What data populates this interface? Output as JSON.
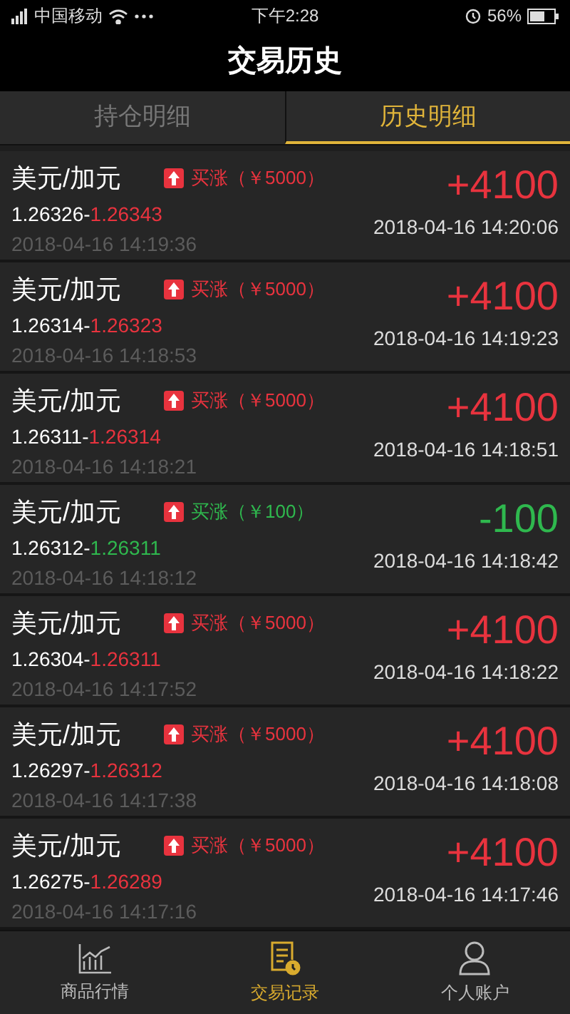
{
  "status_bar": {
    "carrier": "中国移动",
    "time": "下午2:28",
    "battery": "56%"
  },
  "header": {
    "title": "交易历史"
  },
  "tabs": [
    {
      "label": "持仓明细",
      "selected": false
    },
    {
      "label": "历史明细",
      "selected": true
    }
  ],
  "trades": [
    {
      "pair": "美元/加元",
      "direction": "买涨（￥5000）",
      "open_price": "1.26326",
      "separator": "-",
      "close_price": "1.26343",
      "open_time": "2018-04-16 14:19:36",
      "profit": "+4100",
      "close_time": "2018-04-16 14:20:06",
      "kind": "gain"
    },
    {
      "pair": "美元/加元",
      "direction": "买涨（￥5000）",
      "open_price": "1.26314",
      "separator": "-",
      "close_price": "1.26323",
      "open_time": "2018-04-16 14:18:53",
      "profit": "+4100",
      "close_time": "2018-04-16 14:19:23",
      "kind": "gain"
    },
    {
      "pair": "美元/加元",
      "direction": "买涨（￥5000）",
      "open_price": "1.26311",
      "separator": "-",
      "close_price": "1.26314",
      "open_time": "2018-04-16 14:18:21",
      "profit": "+4100",
      "close_time": "2018-04-16 14:18:51",
      "kind": "gain"
    },
    {
      "pair": "美元/加元",
      "direction": "买涨（￥100）",
      "open_price": "1.26312",
      "separator": "-",
      "close_price": "1.26311",
      "open_time": "2018-04-16 14:18:12",
      "profit": "-100",
      "close_time": "2018-04-16 14:18:42",
      "kind": "loss"
    },
    {
      "pair": "美元/加元",
      "direction": "买涨（￥5000）",
      "open_price": "1.26304",
      "separator": "-",
      "close_price": "1.26311",
      "open_time": "2018-04-16 14:17:52",
      "profit": "+4100",
      "close_time": "2018-04-16 14:18:22",
      "kind": "gain"
    },
    {
      "pair": "美元/加元",
      "direction": "买涨（￥5000）",
      "open_price": "1.26297",
      "separator": "-",
      "close_price": "1.26312",
      "open_time": "2018-04-16 14:17:38",
      "profit": "+4100",
      "close_time": "2018-04-16 14:18:08",
      "kind": "gain"
    },
    {
      "pair": "美元/加元",
      "direction": "买涨（￥5000）",
      "open_price": "1.26275",
      "separator": "-",
      "close_price": "1.26289",
      "open_time": "2018-04-16 14:17:16",
      "profit": "+4100",
      "close_time": "2018-04-16 14:17:46",
      "kind": "gain"
    }
  ],
  "bottom_nav": [
    {
      "label": "商品行情",
      "selected": false,
      "kind": "chart"
    },
    {
      "label": "交易记录",
      "selected": true,
      "kind": "records"
    },
    {
      "label": "个人账户",
      "selected": false,
      "kind": "user"
    }
  ]
}
